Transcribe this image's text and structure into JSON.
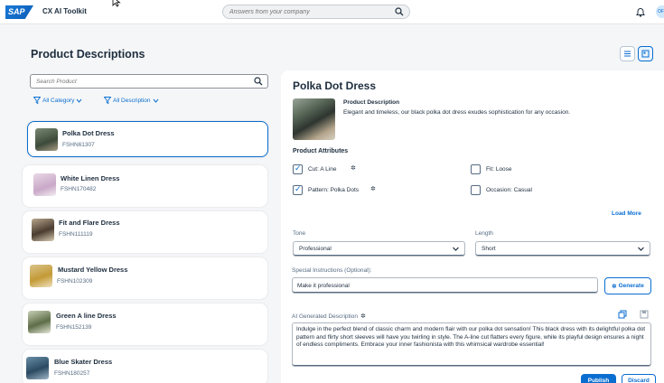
{
  "shell": {
    "logo": "SAP",
    "app_title": "CX AI Toolkit",
    "search_placeholder": "Answers from your company",
    "avatar_initials": "OF"
  },
  "page": {
    "title": "Product Descriptions"
  },
  "list": {
    "search_placeholder": "Search Product",
    "filters": [
      "All Category",
      "All Description"
    ],
    "items": [
      {
        "name": "Polka Dot Dress",
        "sku": "FSHN61307",
        "selected": true
      },
      {
        "name": "White Linen Dress",
        "sku": "FSHN170482"
      },
      {
        "name": "Fit and Flare Dress",
        "sku": "FSHN111119"
      },
      {
        "name": "Mustard Yellow Dress",
        "sku": "FSHN102309"
      },
      {
        "name": "Green A line Dress",
        "sku": "FSHN152139"
      },
      {
        "name": "Blue Skater Dress",
        "sku": "FSHN180257"
      }
    ]
  },
  "detail": {
    "title": "Polka Dot Dress",
    "desc_heading": "Product Description",
    "description": "Elegant and timeless, our black polka dot dress exudes sophistication for any occasion.",
    "attributes_heading": "Product Attributes",
    "attributes": [
      {
        "label": "Cut: A Line",
        "checked": true
      },
      {
        "label": "Fit: Loose",
        "checked": false
      },
      {
        "label": "Pattern: Polka Dots",
        "checked": true
      },
      {
        "label": "Occasion: Casual",
        "checked": false
      }
    ],
    "load_more": "Load More",
    "tone_label": "Tone",
    "tone_value": "Professional",
    "length_label": "Length",
    "length_value": "Short",
    "instructions_label": "Special Instructions (Optional):",
    "instructions_value": "Make it professional",
    "generate": "Generate",
    "ai_label": "AI Generated Description",
    "ai_text": "Indulge in the perfect blend of classic charm and modern flair with our polka dot sensation! This black dress with its delightful polka dot pattern and flirty short sleeves will have you twirling in style. The A-line cut flatters every figure, while its playful design ensures a night of endless compliments. Embrace your inner fashionista with this whimsical wardrobe essential!",
    "publish": "Publish",
    "discard": "Discard"
  },
  "colors": {
    "accent": "#0a6ed1",
    "background": "#f5f6f7",
    "text": "#1d2d3e"
  },
  "icons": [
    "search-icon",
    "bell-icon",
    "list-view-icon",
    "grid-view-icon",
    "filter-icon",
    "chevron-down-icon",
    "magic-wand-icon",
    "copy-icon",
    "save-icon"
  ]
}
